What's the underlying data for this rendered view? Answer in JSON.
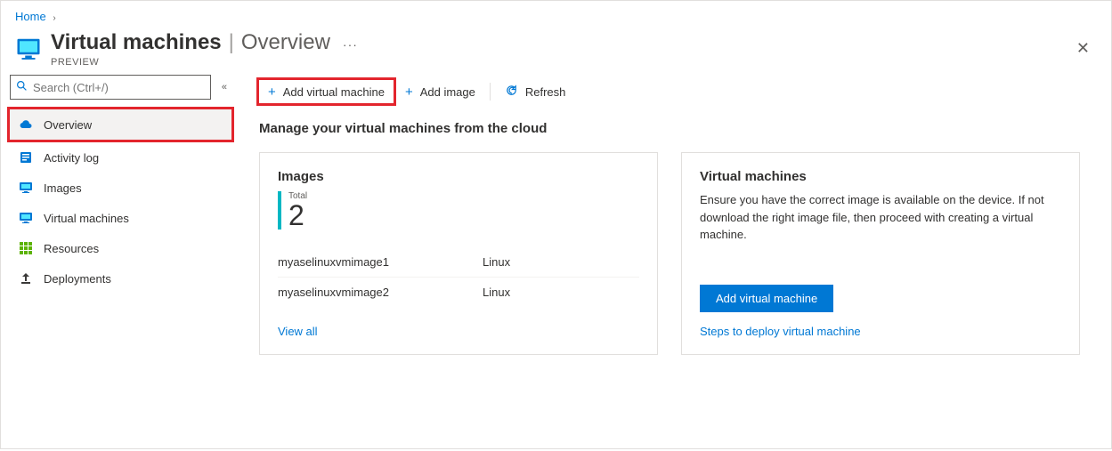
{
  "breadcrumb": {
    "home": "Home"
  },
  "header": {
    "title_bold": "Virtual machines",
    "title_sub": "Overview",
    "preview": "PREVIEW"
  },
  "sidebar": {
    "search_placeholder": "Search (Ctrl+/)",
    "items": [
      {
        "label": "Overview"
      },
      {
        "label": "Activity log"
      },
      {
        "label": "Images"
      },
      {
        "label": "Virtual machines"
      },
      {
        "label": "Resources"
      },
      {
        "label": "Deployments"
      }
    ]
  },
  "toolbar": {
    "add_vm": "Add virtual machine",
    "add_image": "Add image",
    "refresh": "Refresh"
  },
  "main": {
    "subheading": "Manage your virtual machines from the cloud"
  },
  "images_card": {
    "title": "Images",
    "total_label": "Total",
    "total_count": "2",
    "rows": [
      {
        "name": "myaselinuxvmimage1",
        "os": "Linux"
      },
      {
        "name": "myaselinuxvmimage2",
        "os": "Linux"
      }
    ],
    "view_all": "View all"
  },
  "vm_card": {
    "title": "Virtual machines",
    "desc": "Ensure you have the correct image is available on the device. If not download the right image file, then proceed with creating a virtual machine.",
    "button": "Add virtual machine",
    "link": "Steps to deploy virtual machine"
  }
}
